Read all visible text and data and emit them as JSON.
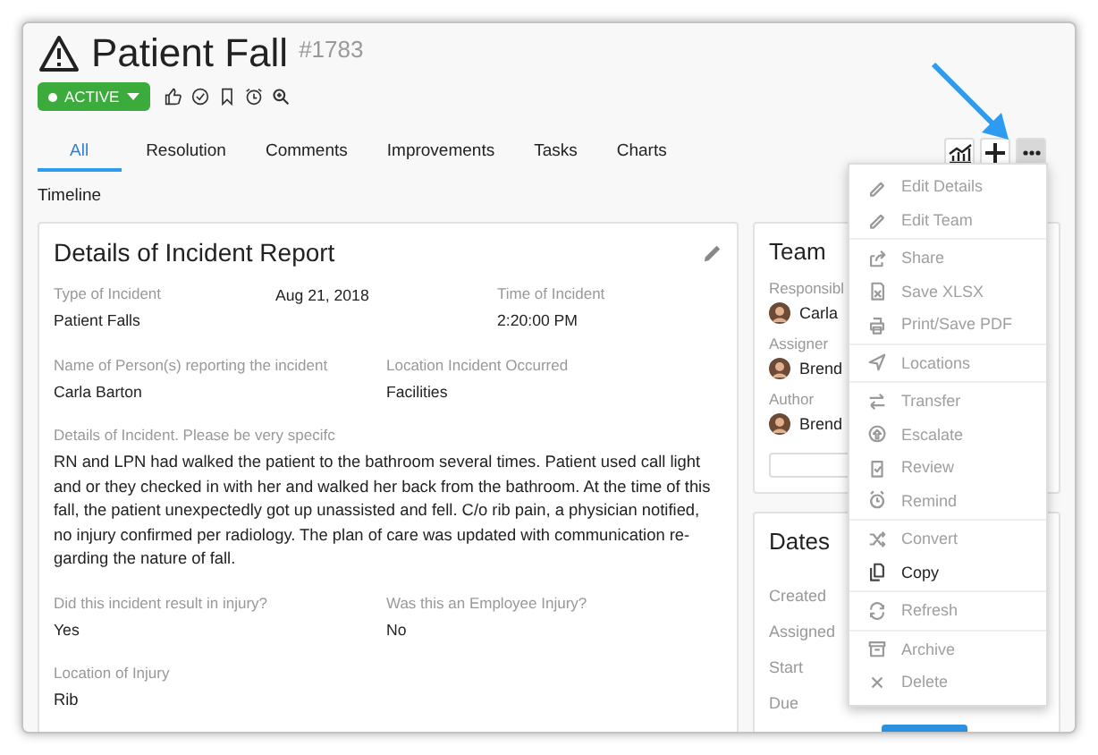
{
  "title": {
    "text": "Patient Fall",
    "number": "#1783"
  },
  "status": {
    "label": "ACTIVE"
  },
  "tabs": [
    {
      "label": "All",
      "selected": true
    },
    {
      "label": "Resolution",
      "selected": false
    },
    {
      "label": "Comments",
      "selected": false
    },
    {
      "label": "Improvements",
      "selected": false
    },
    {
      "label": "Tasks",
      "selected": false
    },
    {
      "label": "Charts",
      "selected": false
    }
  ],
  "tool_buttons": [
    {
      "kind": "chart",
      "selected": false
    },
    {
      "kind": "add",
      "selected": false
    },
    {
      "kind": "more",
      "selected": true
    }
  ],
  "section_label": "Timeline",
  "details": {
    "title": "Details of Incident Report",
    "rows": [
      [
        {
          "label": "Type of Incident",
          "value": "Patient Falls"
        },
        {
          "value": "Aug 21, 2018"
        },
        {
          "label": "Time of Incident",
          "value": "2:20:00 PM"
        }
      ],
      [
        {
          "label": "Name of Person(s) reporting the incident",
          "value": "Carla Barton"
        },
        {
          "label": "Location Incident Occurred",
          "value": "Facilities"
        }
      ],
      [
        {
          "label": "Details of Incident. Please be very specifc",
          "value": "RN and LPN had walked the patient to the bathroom several times. Patient used call light and or they checked in with her and walked her back from the bathroom. At the time of this fall, the patient unexpectedly got up unassisted and fell. C/o rib pain, a physician notified, no injury confirmed per radiology. The plan of care was updated with communication re-garding the nature of fall."
        }
      ],
      [
        {
          "label": "Did this incident result in injury?",
          "value": "Yes"
        },
        {
          "label": "Was this an Employee Injury?",
          "value": "No"
        }
      ],
      [
        {
          "label": "Location of Injury",
          "value": "Rib"
        }
      ]
    ]
  },
  "team": {
    "title": "Team",
    "roles": [
      {
        "role": "Responsibl",
        "name": "Carla"
      },
      {
        "role": "Assigner",
        "name": "Brend"
      },
      {
        "role": "Author",
        "name": "Brend"
      }
    ]
  },
  "dates": {
    "title": "Dates",
    "rows": [
      "Created",
      "Assigned",
      "Start",
      "Due"
    ]
  },
  "menu": {
    "groups": [
      [
        {
          "label": "Edit Details",
          "disabled": true
        },
        {
          "label": "Edit Team",
          "disabled": true
        }
      ],
      [
        {
          "label": "Share",
          "disabled": true
        },
        {
          "label": "Save XLSX",
          "disabled": true
        },
        {
          "label": "Print/Save PDF",
          "disabled": true
        }
      ],
      [
        {
          "label": "Locations",
          "disabled": true
        }
      ],
      [
        {
          "label": "Transfer",
          "disabled": true
        },
        {
          "label": "Escalate",
          "disabled": true
        },
        {
          "label": "Review",
          "disabled": true
        },
        {
          "label": "Remind",
          "disabled": true
        }
      ],
      [
        {
          "label": "Convert",
          "disabled": true
        },
        {
          "label": "Copy",
          "disabled": false
        }
      ],
      [
        {
          "label": "Refresh",
          "disabled": true
        }
      ],
      [
        {
          "label": "Archive",
          "disabled": true
        },
        {
          "label": "Delete",
          "disabled": true
        }
      ]
    ]
  }
}
